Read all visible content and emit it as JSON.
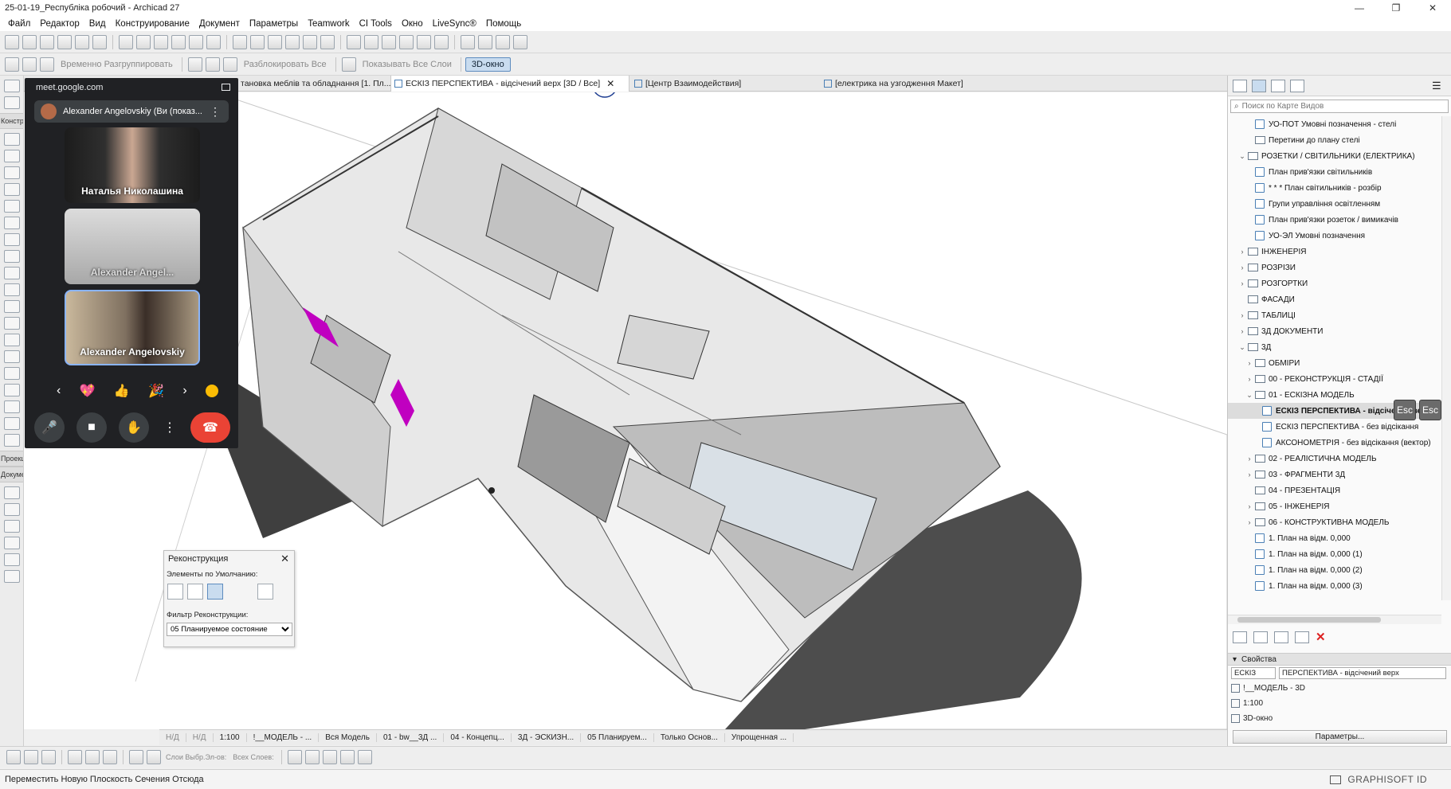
{
  "window": {
    "title": "25-01-19_Республіка робочий - Archicad 27",
    "controls": [
      "—",
      "❐",
      "✕"
    ]
  },
  "menu": [
    "Файл",
    "Редактор",
    "Вид",
    "Конструирование",
    "Документ",
    "Параметры",
    "Teamwork",
    "CI Tools",
    "Окно",
    "LiveSync®",
    "Помощь"
  ],
  "toolbar2": {
    "ungroup_label": "Временно Разгруппировать",
    "unlock_label": "Разблокировать Все",
    "show_layers_label": "Показывать Все Слои",
    "view3d_label": "3D-окно"
  },
  "left_tool_labels": {
    "construct": "Констр",
    "project": "Проекц",
    "document": "Докуме"
  },
  "tabs": [
    {
      "label": "тановка меблів та обладнання [1. Пл...",
      "active": false
    },
    {
      "label": "ЕСКІЗ ПЕРСПЕКТИВА - відсічений верх [3D / Все]",
      "active": true,
      "close": "✕"
    },
    {
      "label": "[Центр Взаимодействия]",
      "active": false
    },
    {
      "label": "[електрика на узгодження Макет]",
      "active": false
    }
  ],
  "meet": {
    "url": "meet.google.com",
    "self_label": "Alexander Angelovskiy (Ви (показ...",
    "participants": [
      {
        "name": "Наталья Николашина"
      },
      {
        "name": "Alexander Angel..."
      },
      {
        "name": "Alexander Angelovskiy"
      }
    ],
    "reactions": [
      "‹",
      "💖",
      "👍",
      "🎉",
      "›"
    ]
  },
  "reconstruction": {
    "title": "Реконструкция",
    "defaults_label": "Элементы по Умолчанию:",
    "filter_label": "Фильтр Реконструкции:",
    "filter_value": "05 Планируемое состояние"
  },
  "navigator": {
    "search_placeholder": "Поиск по Карте Видов",
    "tree": [
      {
        "label": "УО-ПОТ Умовні позначення - стелі",
        "indent": 2,
        "kind": "view"
      },
      {
        "label": "Перетини до плану стелі",
        "indent": 2,
        "kind": "folder"
      },
      {
        "label": "РОЗЕТКИ / СВІТИЛЬНИКИ (ЕЛЕКТРИКА)",
        "indent": 1,
        "kind": "folder",
        "arrow": "⌄"
      },
      {
        "label": "План прив'язки світильників",
        "indent": 2,
        "kind": "view"
      },
      {
        "label": "* * * План світильників - розбір",
        "indent": 2,
        "kind": "view"
      },
      {
        "label": "Групи управління освітленням",
        "indent": 2,
        "kind": "view"
      },
      {
        "label": "План прив'язки розеток / вимикачів",
        "indent": 2,
        "kind": "view"
      },
      {
        "label": "УО-ЭЛ Умовні позначення",
        "indent": 2,
        "kind": "view"
      },
      {
        "label": "ІНЖЕНЕРІЯ",
        "indent": 1,
        "kind": "folder",
        "arrow": "›"
      },
      {
        "label": "РОЗРІЗИ",
        "indent": 1,
        "kind": "folder",
        "arrow": "›"
      },
      {
        "label": "РОЗГОРТКИ",
        "indent": 1,
        "kind": "folder",
        "arrow": "›"
      },
      {
        "label": "ФАСАДИ",
        "indent": 1,
        "kind": "folder"
      },
      {
        "label": "ТАБЛИЦІ",
        "indent": 1,
        "kind": "folder",
        "arrow": "›"
      },
      {
        "label": "3Д ДОКУМЕНТИ",
        "indent": 1,
        "kind": "folder",
        "arrow": "›"
      },
      {
        "label": "3Д",
        "indent": 1,
        "kind": "folder",
        "arrow": "⌄"
      },
      {
        "label": "ОБМІРИ",
        "indent": 2,
        "kind": "folder",
        "arrow": "›"
      },
      {
        "label": "00 - РЕКОНСТРУКЦІЯ - СТАДІЇ",
        "indent": 2,
        "kind": "folder",
        "arrow": "›"
      },
      {
        "label": "01 - ЕСКІЗНА МОДЕЛЬ",
        "indent": 2,
        "kind": "folder",
        "arrow": "⌄"
      },
      {
        "label": "ЕСКІЗ ПЕРСПЕКТИВА - відсічений верх",
        "indent": 3,
        "kind": "view",
        "selected": true
      },
      {
        "label": "ЕСКІЗ ПЕРСПЕКТИВА - без відсікання",
        "indent": 3,
        "kind": "view"
      },
      {
        "label": "АКСОНОМЕТРІЯ - без відсікання (вектор)",
        "indent": 3,
        "kind": "view"
      },
      {
        "label": "02 - РЕАЛІСТИЧНА МОДЕЛЬ",
        "indent": 2,
        "kind": "folder",
        "arrow": "›"
      },
      {
        "label": "03 - ФРАГМЕНТИ 3Д",
        "indent": 2,
        "kind": "folder",
        "arrow": "›"
      },
      {
        "label": "04 - ПРЕЗЕНТАЦІЯ",
        "indent": 2,
        "kind": "folder"
      },
      {
        "label": "05 - ІНЖЕНЕРІЯ",
        "indent": 2,
        "kind": "folder",
        "arrow": "›"
      },
      {
        "label": "06 - КОНСТРУКТИВНА МОДЕЛЬ",
        "indent": 2,
        "kind": "folder",
        "arrow": "›"
      },
      {
        "label": "1. План на відм. 0,000",
        "indent": 2,
        "kind": "view"
      },
      {
        "label": "1. План на відм. 0,000 (1)",
        "indent": 2,
        "kind": "view"
      },
      {
        "label": "1. План на відм. 0,000 (2)",
        "indent": 2,
        "kind": "view"
      },
      {
        "label": "1. План на відм. 0,000 (3)",
        "indent": 2,
        "kind": "view"
      }
    ],
    "esc_label": "Esc"
  },
  "properties": {
    "header": "Свойства",
    "id_value": "ЕСКІЗ",
    "name_value": "ПЕРСПЕКТИВА - відсічений верх",
    "layer_combo": "!__МОДЕЛЬ - 3D",
    "scale": "1:100",
    "window_type": "3D-окно",
    "params_button": "Параметры..."
  },
  "nav_bar": [
    "Н/Д",
    "Н/Д",
    "1:100",
    "!__МОДЕЛЬ - ...",
    "Вся Модель",
    "01 - bw__3Д ...",
    "04 - Концепц...",
    "3Д - ЭСКИЗН...",
    "05 Планируем...",
    "Только Основ...",
    "Упрощенная ..."
  ],
  "bottom_tools": {
    "layers_label": "Слои Выбр.Эл-ов:",
    "all_layers_label": "Всех Слоев:"
  },
  "status": {
    "message": "Переместить Новую Плоскость Сечения Отсюда",
    "graphisoft_id": "GRAPHISOFT ID"
  }
}
